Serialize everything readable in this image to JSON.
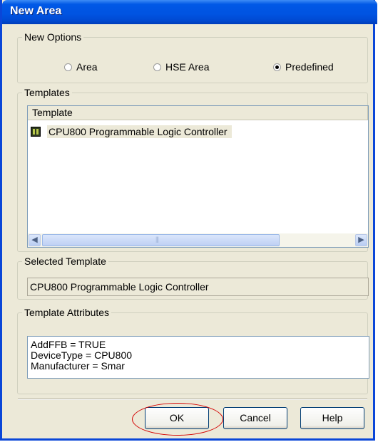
{
  "window": {
    "title": "New Area"
  },
  "new_options": {
    "legend": "New Options",
    "options": [
      {
        "label": "Area",
        "selected": false
      },
      {
        "label": "HSE Area",
        "selected": false
      },
      {
        "label": "Predefined",
        "selected": true
      }
    ]
  },
  "templates": {
    "legend": "Templates",
    "column_header": "Template",
    "items": [
      {
        "label": "CPU800 Programmable Logic Controller",
        "icon": "plc-device-icon"
      }
    ]
  },
  "selected_template": {
    "legend": "Selected Template",
    "value": "CPU800 Programmable Logic Controller"
  },
  "template_attributes": {
    "legend": "Template Attributes",
    "lines": [
      "AddFFB = TRUE",
      "DeviceType = CPU800",
      "Manufacturer = Smar"
    ]
  },
  "buttons": {
    "ok": "OK",
    "cancel": "Cancel",
    "help": "Help"
  },
  "colors": {
    "title_bar": "#0054e3",
    "frame": "#ece9d8",
    "highlight_oval": "#d40000"
  }
}
